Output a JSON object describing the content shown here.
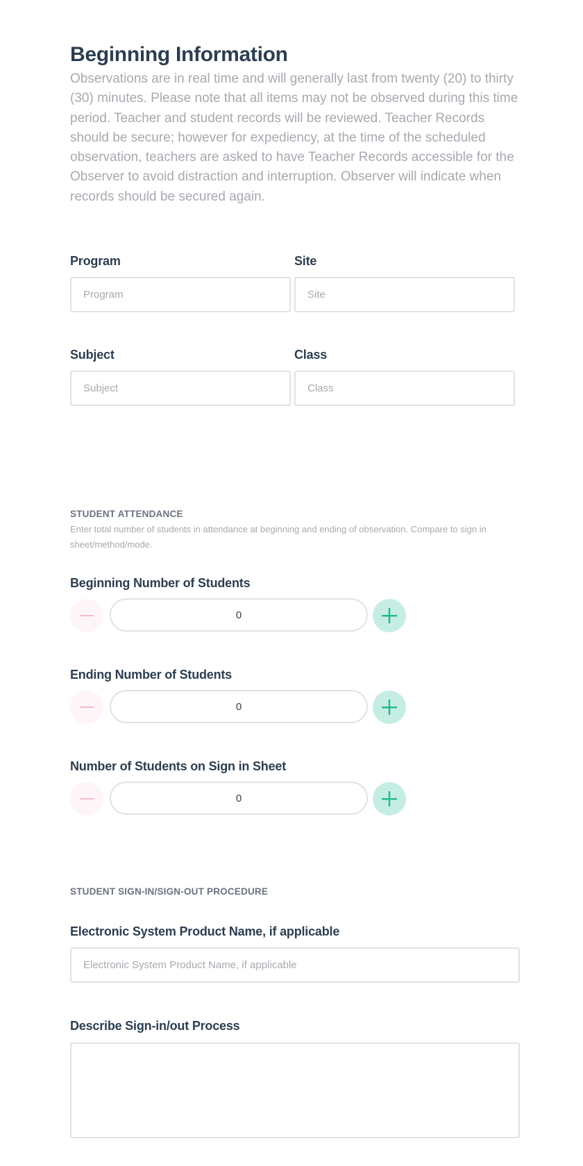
{
  "header": {
    "title": "Beginning Information",
    "intro": "Observations are in real time and will generally last from twenty (20) to thirty (30) minutes. Please note that all items may not be observed during this time period. Teacher and student records will be reviewed. Teacher Records should be secure; however for expediency, at the time of the scheduled observation, teachers are asked to have Teacher Records accessible for the Observer to avoid distraction and interruption. Observer will indicate when records should be secured again."
  },
  "fields": {
    "program": {
      "label": "Program",
      "placeholder": "Program",
      "value": ""
    },
    "site": {
      "label": "Site",
      "placeholder": "Site",
      "value": ""
    },
    "subject": {
      "label": "Subject",
      "placeholder": "Subject",
      "value": ""
    },
    "class": {
      "label": "Class",
      "placeholder": "Class",
      "value": ""
    }
  },
  "attendance": {
    "title": "STUDENT ATTENDANCE",
    "description": "Enter total number of students in attendance at beginning and ending of observation. Compare to sign in sheet/method/mode.",
    "steppers": [
      {
        "label": "Beginning Number of Students",
        "value": "0"
      },
      {
        "label": "Ending Number of Students",
        "value": "0"
      },
      {
        "label": "Number of Students on Sign in Sheet",
        "value": "0"
      }
    ]
  },
  "signin": {
    "title": "STUDENT SIGN-IN/SIGN-OUT PROCEDURE",
    "product": {
      "label": "Electronic System Product Name, if applicable",
      "placeholder": "Electronic System Product Name, if applicable",
      "value": ""
    },
    "process": {
      "label": "Describe Sign-in/out Process",
      "value": ""
    }
  },
  "colors": {
    "heading": "#2c3e50",
    "muted": "#a8a8b0",
    "plus_bg": "#c6ede4",
    "plus_icon": "#1fb98f",
    "minus_bg": "#fdf5f7",
    "minus_icon": "#f6bccb",
    "border": "#e2e2e2"
  }
}
